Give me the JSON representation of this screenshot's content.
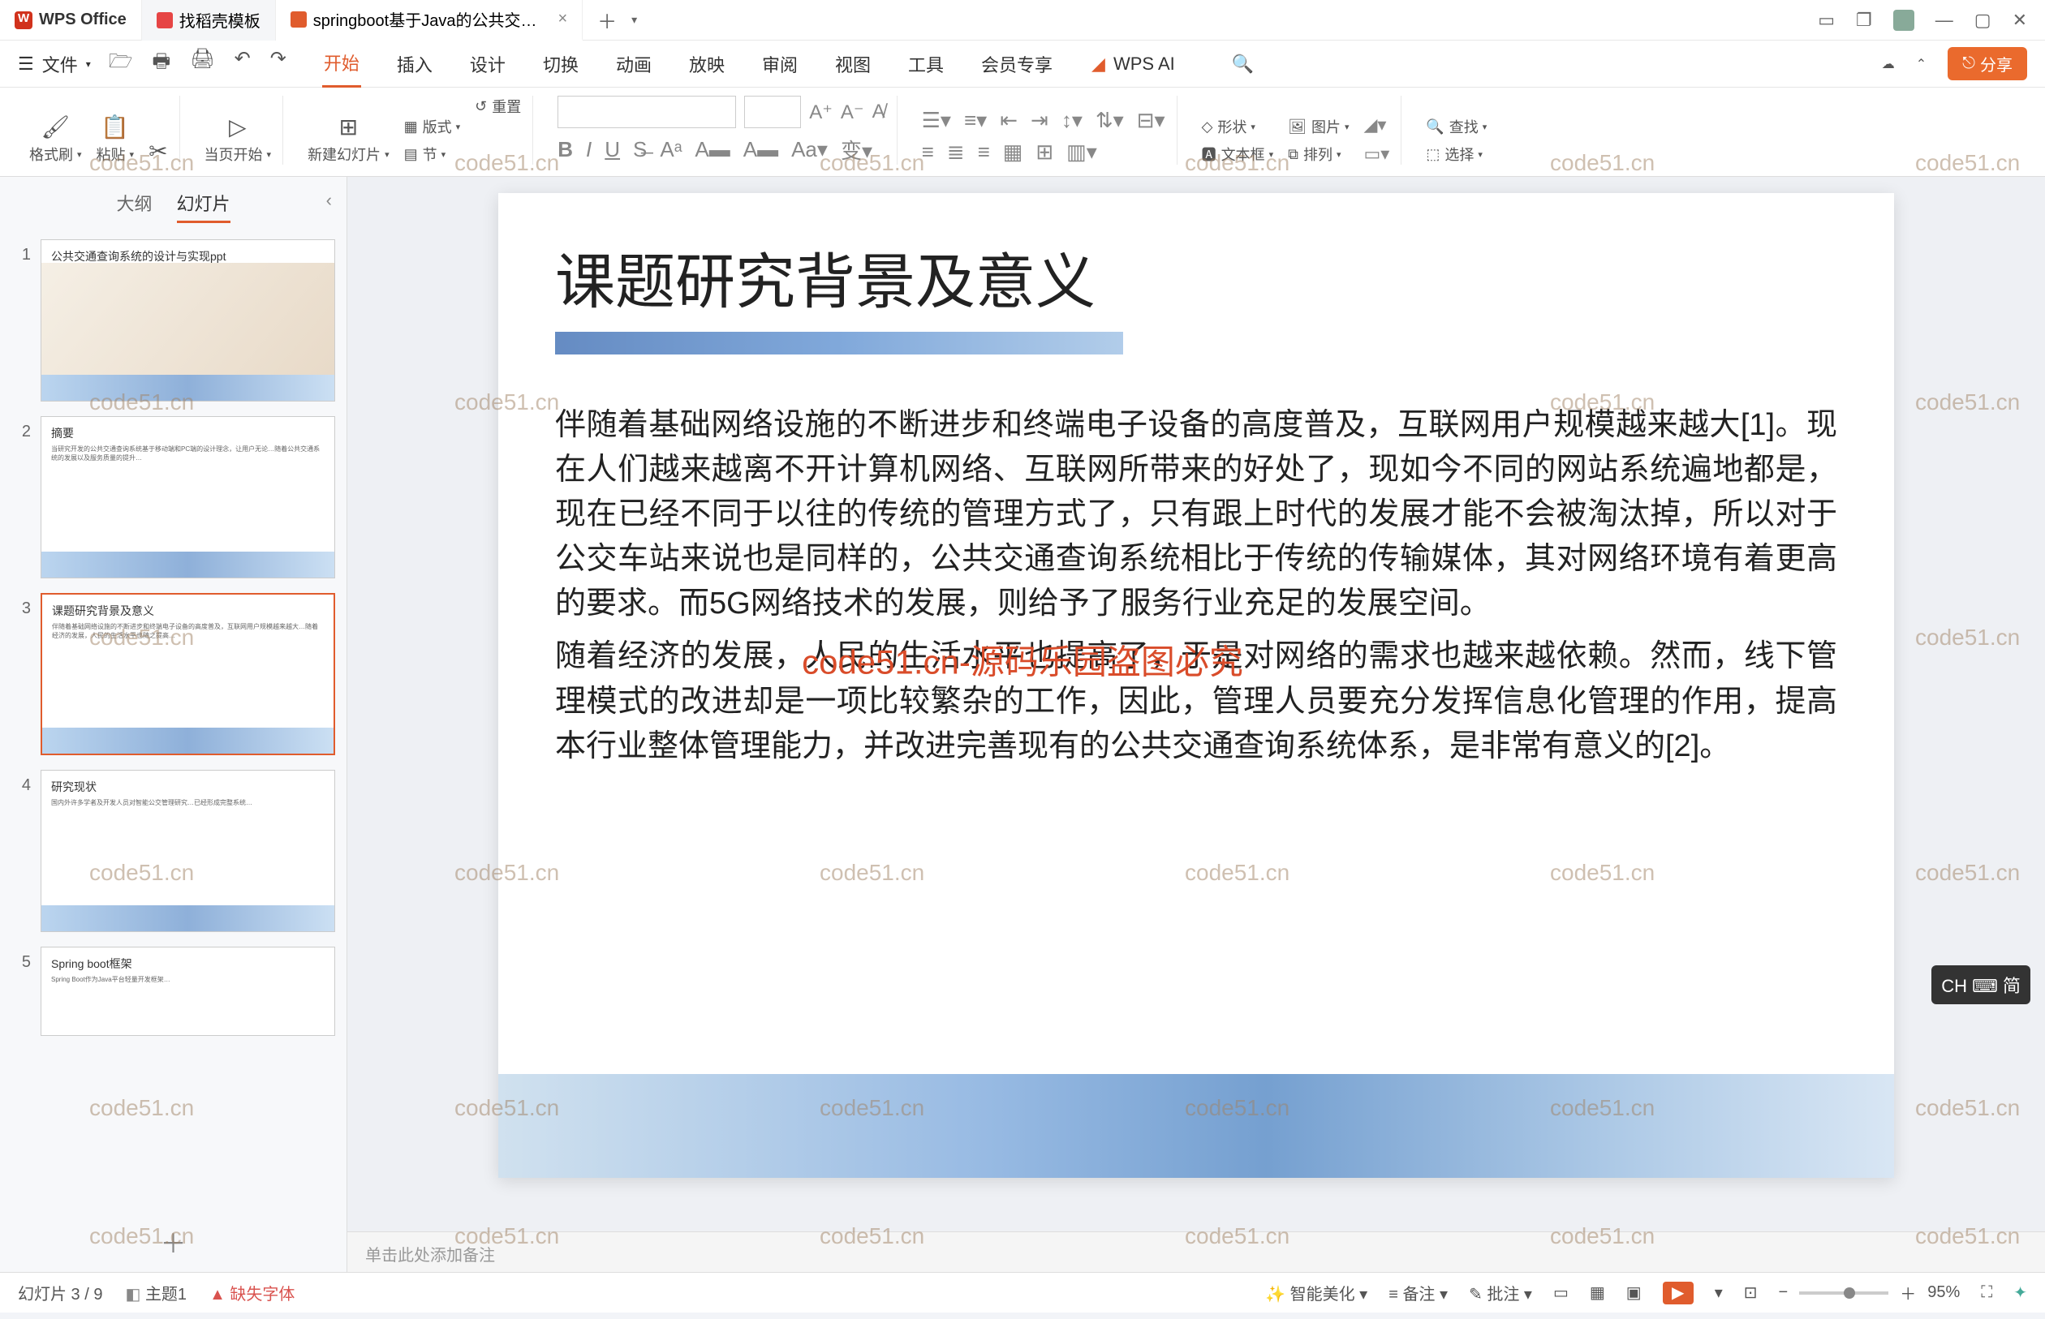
{
  "titlebar": {
    "brand": "WPS Office",
    "tab1": "找稻壳模板",
    "tab2": "springboot基于Java的公共交…"
  },
  "menubar": {
    "file": "文件",
    "tabs": [
      "开始",
      "插入",
      "设计",
      "切换",
      "动画",
      "放映",
      "审阅",
      "视图",
      "工具",
      "会员专享"
    ],
    "wpsai": "WPS AI",
    "share": "分享"
  },
  "ribbon": {
    "format_painter": "格式刷",
    "paste": "粘贴",
    "start_from": "当页开始",
    "new_slide": "新建幻灯片",
    "layout": "版式",
    "section": "节",
    "reset": "重置",
    "text_box": "文本框",
    "shapes": "形状",
    "pictures": "图片",
    "arrange": "排列",
    "find": "查找",
    "select": "选择"
  },
  "sidepane": {
    "tab_outline": "大纲",
    "tab_slides": "幻灯片",
    "slides": [
      {
        "n": "1",
        "title": "公共交通查询系统的设计与实现ppt"
      },
      {
        "n": "2",
        "title": "摘要"
      },
      {
        "n": "3",
        "title": "课题研究背景及意义"
      },
      {
        "n": "4",
        "title": "研究现状"
      },
      {
        "n": "5",
        "title": "Spring boot框架"
      }
    ]
  },
  "slide": {
    "title": "课题研究背景及意义",
    "p1": "伴随着基础网络设施的不断进步和终端电子设备的高度普及，互联网用户规模越来越大[1]。现在人们越来越离不开计算机网络、互联网所带来的好处了，现如今不同的网站系统遍地都是，现在已经不同于以往的传统的管理方式了，只有跟上时代的发展才能不会被淘汰掉，所以对于公交车站来说也是同样的，公共交通查询系统相比于传统的传输媒体，其对网络环境有着更高的要求。而5G网络技术的发展，则给予了服务行业充足的发展空间。",
    "p2": "随着经济的发展，人民的生活水平也提高了，于是对网络的需求也越来越依赖。然而，线下管理模式的改进却是一项比较繁杂的工作，因此，管理人员要充分发挥信息化管理的作用，提高本行业整体管理能力，并改进完善现有的公共交通查询系统体系，是非常有意义的[2]。"
  },
  "notes_placeholder": "单击此处添加备注",
  "status": {
    "slide_pos": "幻灯片 3 / 9",
    "theme": "主题1",
    "missing_fonts": "缺失字体",
    "smart_beautify": "智能美化",
    "notes": "备注",
    "review": "批注",
    "zoom": "95%"
  },
  "watermark": {
    "short": "code51.cn",
    "center": "code51.cn-源码乐园盗图必究"
  },
  "ime": "CH ⌨ 简"
}
